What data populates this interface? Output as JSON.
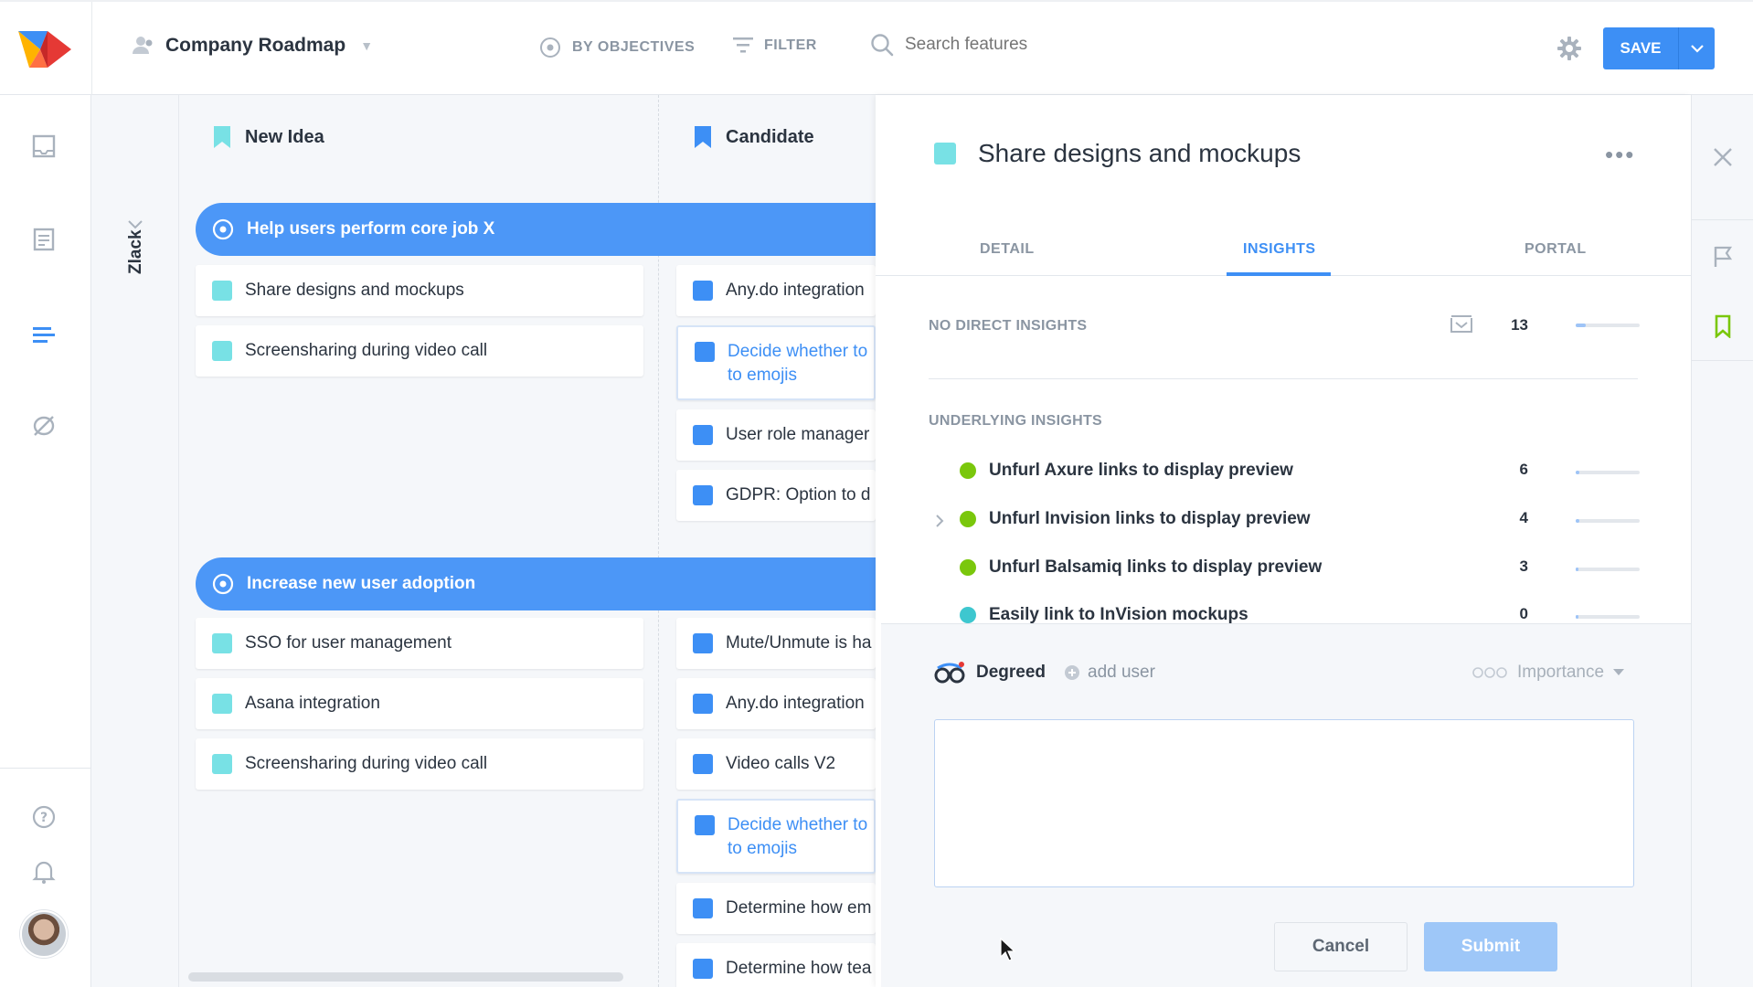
{
  "header": {
    "roadmap_title": "Company Roadmap",
    "by_objectives_label": "BY OBJECTIVES",
    "filter_label": "FILTER",
    "search_placeholder": "Search features",
    "save_label": "SAVE"
  },
  "board": {
    "lane_name": "Zlack",
    "columns": [
      {
        "label": "New Idea"
      },
      {
        "label": "Candidate"
      }
    ],
    "objectives": [
      {
        "title": "Help users perform core job X",
        "new_idea": [
          "Share designs and mockups",
          "Screensharing during video call"
        ],
        "candidate": [
          "Any.do integration",
          "Decide whether to to emojis",
          "User role manager",
          "GDPR: Option to d"
        ]
      },
      {
        "title": "Increase new user adoption",
        "new_idea": [
          "SSO for user management",
          "Asana integration",
          "Screensharing during video call"
        ],
        "candidate": [
          "Mute/Unmute is ha",
          "Any.do integration",
          "Video calls V2",
          "Decide whether to to emojis",
          "Determine how em",
          "Determine how tea"
        ]
      }
    ]
  },
  "detail": {
    "title": "Share designs and mockups",
    "more_label": "•••",
    "tabs": [
      {
        "label": "DETAIL"
      },
      {
        "label": "INSIGHTS"
      },
      {
        "label": "PORTAL"
      }
    ],
    "active_tab": "INSIGHTS",
    "no_direct_label": "NO DIRECT INSIGHTS",
    "no_direct_count": "13",
    "no_direct_level": 0.15,
    "underlying_label": "UNDERLYING INSIGHTS",
    "insights": [
      {
        "title": "Unfurl Axure links to display preview",
        "count": "6",
        "level": 0.06,
        "status_color": "#7ac70c"
      },
      {
        "title": "Unfurl Invision links to display preview",
        "count": "4",
        "level": 0.05,
        "status_color": "#7ac70c"
      },
      {
        "title": "Unfurl Balsamiq links to display preview",
        "count": "3",
        "level": 0.04,
        "status_color": "#7ac70c"
      },
      {
        "title": "Easily link to InVision mockups",
        "count": "0",
        "level": 0.0,
        "status_color": "#3ec7cf"
      }
    ],
    "compose": {
      "company": "Degreed",
      "add_user_label": "add user",
      "importance_label": "Importance",
      "cancel_label": "Cancel",
      "submit_label": "Submit"
    }
  },
  "colors": {
    "accent": "#3d8ff5",
    "objective_bar": "#4c97f7",
    "feature_teal": "#78e1e5",
    "insight_green": "#7ac70c"
  }
}
